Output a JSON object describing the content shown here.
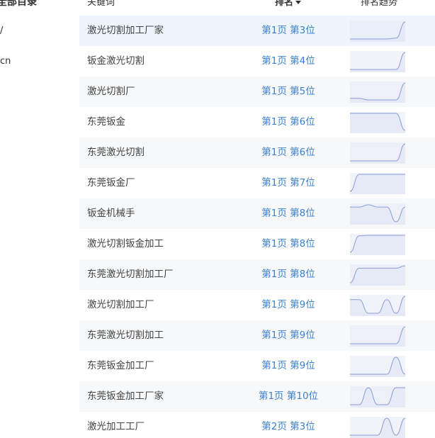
{
  "sidebar": {
    "title": "全部目录",
    "items": [
      {
        "label": "/"
      },
      {
        "label": "cn"
      }
    ]
  },
  "table": {
    "headers": {
      "keyword": "关键词",
      "rank": "排名",
      "trend": "排名趋势"
    },
    "colors": {
      "rank_link": "#3a7fd0",
      "sparkline_stroke": "#8a9bd6",
      "sparkline_fill": "#e6eaf6",
      "row_alt_bg": "#f7f8fa",
      "row_active_bg": "#eef5fd"
    },
    "rows": [
      {
        "keyword": "激光切割加工厂家",
        "rank": "第1页 第3位",
        "trend": [
          3,
          3,
          3,
          3,
          3,
          2.9,
          1
        ]
      },
      {
        "keyword": "钣金激光切割",
        "rank": "第1页 第4位",
        "trend": [
          4,
          4,
          4,
          4,
          4,
          4,
          3.95
        ]
      },
      {
        "keyword": "激光切割厂",
        "rank": "第1页 第5位",
        "trend": [
          5,
          5,
          5.2,
          5.2,
          5.2,
          5.2,
          3
        ]
      },
      {
        "keyword": "东莞钣金",
        "rank": "第1页 第6位",
        "trend": [
          6,
          6,
          6,
          6,
          6,
          6,
          6.05
        ]
      },
      {
        "keyword": "东莞激光切割",
        "rank": "第1页 第6位",
        "trend": [
          6.05,
          6.05,
          6.05,
          6.05,
          6.05,
          6.05,
          6
        ]
      },
      {
        "keyword": "东莞钣金厂",
        "rank": "第1页 第7位",
        "trend": [
          12,
          7,
          7,
          7,
          7,
          7,
          7
        ]
      },
      {
        "keyword": "钣金机械手",
        "rank": "第1页 第8位",
        "trend": [
          8,
          8,
          7.7,
          8,
          8,
          10,
          8
        ]
      },
      {
        "keyword": "激光切割钣金加工",
        "rank": "第1页 第8位",
        "trend": [
          14,
          8.2,
          8,
          8,
          8,
          8,
          8
        ]
      },
      {
        "keyword": "东莞激光切割加工厂",
        "rank": "第1页 第8位",
        "trend": [
          15,
          9,
          9,
          9,
          9,
          9,
          8
        ]
      },
      {
        "keyword": "激光切割加工厂",
        "rank": "第1页 第9位",
        "trend": [
          9,
          9,
          11,
          11,
          9,
          11,
          8.5
        ]
      },
      {
        "keyword": "东莞激光切割加工",
        "rank": "第1页 第9位",
        "trend": [
          10,
          10,
          10,
          10,
          10,
          10,
          9
        ]
      },
      {
        "keyword": "东莞钣金加工厂",
        "rank": "第1页 第9位",
        "trend": [
          9.5,
          9.5,
          9.5,
          9.5,
          9.5,
          9,
          9.5
        ]
      },
      {
        "keyword": "东莞钣金加工厂家",
        "rank": "第1页 第10位",
        "trend": [
          10.2,
          10.2,
          10,
          10.2,
          10.2,
          10,
          10
        ]
      },
      {
        "keyword": "激光加工工厂",
        "rank": "第2页 第3位",
        "trend": [
          13,
          13,
          13,
          13,
          12,
          13,
          12
        ]
      }
    ]
  }
}
